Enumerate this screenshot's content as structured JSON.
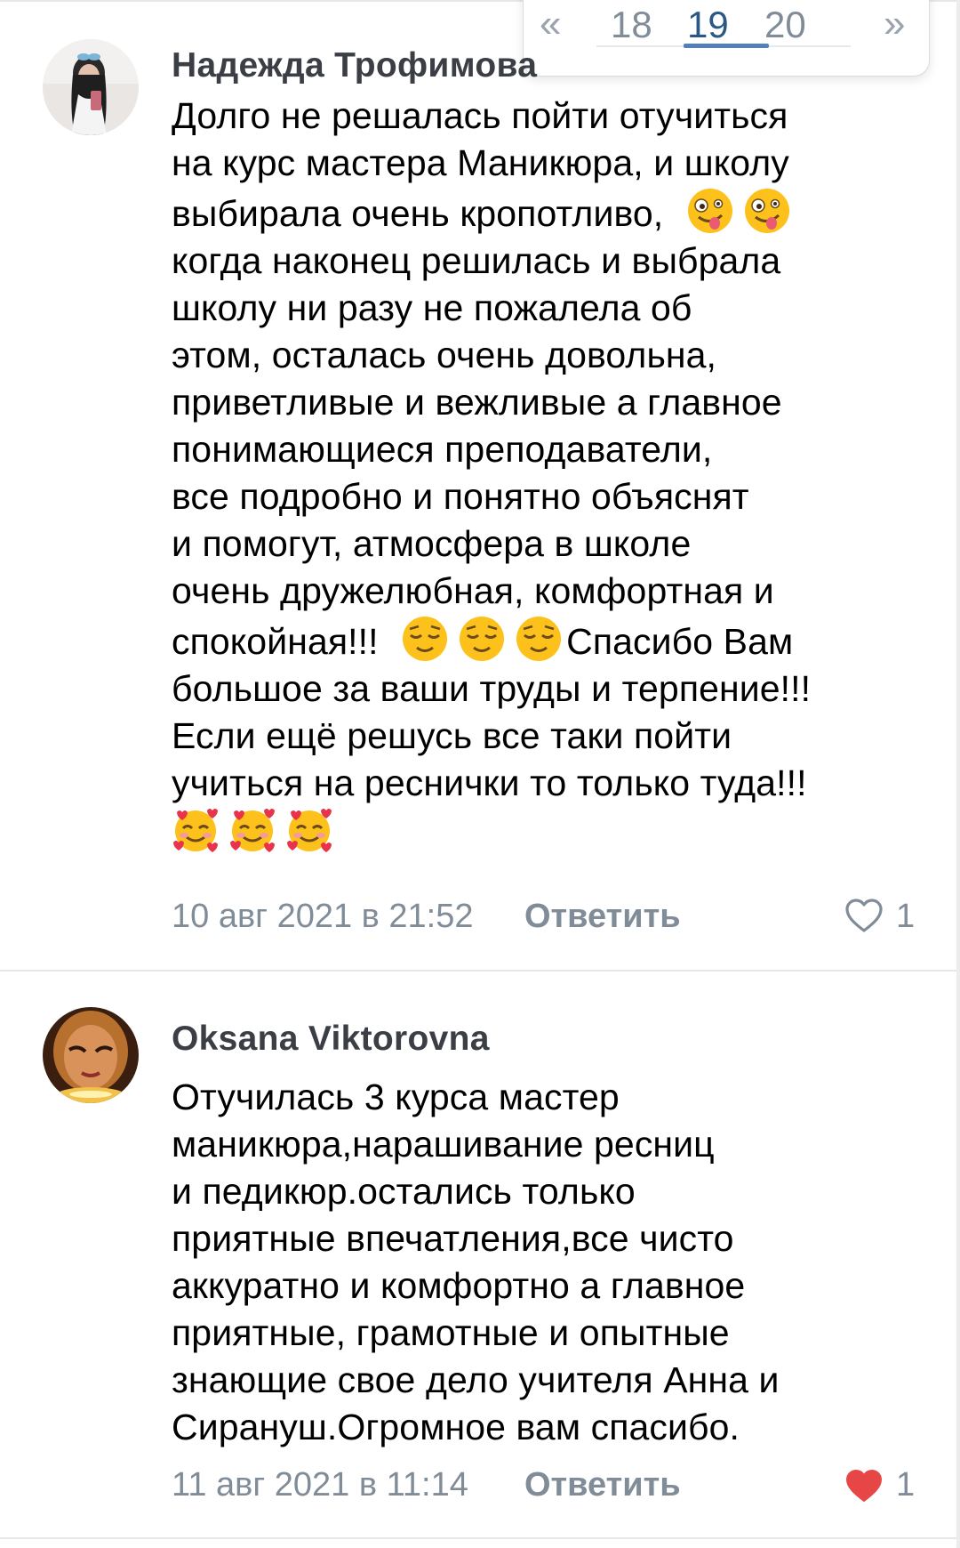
{
  "pagination": {
    "prev_icon": "«",
    "pages": [
      "18",
      "19",
      "20"
    ],
    "current": "19",
    "next_icon": "»"
  },
  "comments": [
    {
      "author": "Надежда Трофимова",
      "lines": [
        "Долго не решалась пойти отучиться",
        "на курс мастера Маникюра, и школу",
        "выбирала очень кропотливо,",
        "когда наконец решилась и выбрала",
        "школу ни разу не пожалела об",
        "этом, осталась очень довольна,",
        "приветливые и вежливые а главное",
        "понимающиеся преподаватели,",
        "все подробно и понятно объяснят",
        "и помогут, атмосфера в школе",
        "очень дружелюбная, комфортная и",
        "спокойная!!!",
        "Спасибо Вам",
        "большое за ваши труды и терпение!!!",
        "Если ещё решусь все таки пойти",
        "учиться на реснички то только туда!!!"
      ],
      "date": "10 авг 2021 в 21:52",
      "reply_label": "Ответить",
      "likes": "1",
      "liked": false,
      "emoji_icons": [
        "zany-face-emoji",
        "relieved-face-emoji",
        "smiling-face-with-hearts-emoji"
      ]
    },
    {
      "author": "Oksana Viktorovna",
      "lines": [
        "Отучилась  3 курса мастер",
        "маникюра,нарашивание ресниц",
        "и педикюр.остались только",
        "приятные впечатления,все чисто",
        "аккуратно и комфортно а главное",
        "приятные, грамотные и опытные",
        "знающие свое дело учителя Анна и",
        "Сирануш.Огромное вам спасибо."
      ],
      "date": "11 авг 2021 в 11:14",
      "reply_label": "Ответить",
      "likes": "1",
      "liked": true
    }
  ],
  "colors": {
    "author": "#3b3f45",
    "meta": "#818c99",
    "pager_active": "#2a5885",
    "pager_underline": "#5181b8",
    "heart_liked": "#e64646",
    "divider": "#e5e7ea"
  }
}
